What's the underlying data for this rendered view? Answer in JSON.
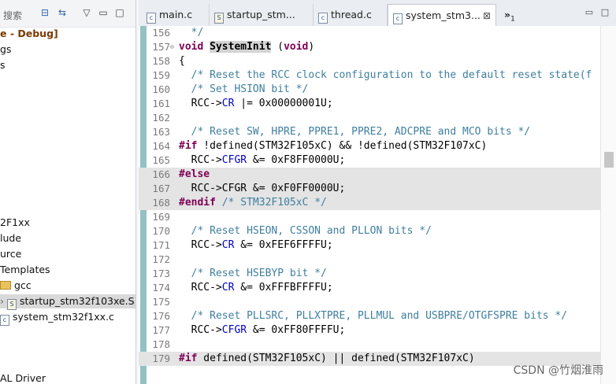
{
  "left_panel": {
    "search_placeholder": "搜索",
    "items": [
      {
        "label": "e - Debug]"
      },
      {
        "label": "gs"
      },
      {
        "label": "s"
      },
      {
        "label": "2F1xx"
      },
      {
        "label": "lude"
      },
      {
        "label": "urce"
      },
      {
        "label": "Templates"
      },
      {
        "label": "gcc"
      },
      {
        "label": "startup_stm32f103xe.S"
      },
      {
        "label": "system_stm32f1xx.c"
      },
      {
        "label": "AL Driver"
      }
    ]
  },
  "tabs": [
    {
      "label": "main.c",
      "icon": "c-file-icon"
    },
    {
      "label": "startup_stm...",
      "icon": "asm-file-icon"
    },
    {
      "label": "thread.c",
      "icon": "c-file-icon"
    },
    {
      "label": "system_stm3...",
      "icon": "c-file-icon",
      "active": true
    }
  ],
  "tab_overflow": {
    "label": "»",
    "count": "1"
  },
  "code_lines": [
    {
      "n": "156",
      "t": "  */"
    },
    {
      "n": "157",
      "t": "void SystemInit (void)"
    },
    {
      "n": "158",
      "t": "{"
    },
    {
      "n": "159",
      "t": "  /* Reset the RCC clock configuration to the default reset state(f"
    },
    {
      "n": "160",
      "t": "  /* Set HSION bit */"
    },
    {
      "n": "161",
      "t": "  RCC->CR |= 0x00000001U;"
    },
    {
      "n": "162",
      "t": ""
    },
    {
      "n": "163",
      "t": "  /* Reset SW, HPRE, PPRE1, PPRE2, ADCPRE and MCO bits */"
    },
    {
      "n": "164",
      "t": "#if !defined(STM32F105xC) && !defined(STM32F107xC)"
    },
    {
      "n": "165",
      "t": "  RCC->CFGR &= 0xF8FF0000U;"
    },
    {
      "n": "166",
      "t": "#else"
    },
    {
      "n": "167",
      "t": "  RCC->CFGR &= 0xF0FF0000U;"
    },
    {
      "n": "168",
      "t": "#endif /* STM32F105xC */"
    },
    {
      "n": "169",
      "t": ""
    },
    {
      "n": "170",
      "t": "  /* Reset HSEON, CSSON and PLLON bits */"
    },
    {
      "n": "171",
      "t": "  RCC->CR &= 0xFEF6FFFFU;"
    },
    {
      "n": "172",
      "t": ""
    },
    {
      "n": "173",
      "t": "  /* Reset HSEBYP bit */"
    },
    {
      "n": "174",
      "t": "  RCC->CR &= 0xFFFBFFFFU;"
    },
    {
      "n": "175",
      "t": ""
    },
    {
      "n": "176",
      "t": "  /* Reset PLLSRC, PLLXTPRE, PLLMUL and USBPRE/OTGFSPRE bits */"
    },
    {
      "n": "177",
      "t": "  RCC->CFGR &= 0xFF80FFFFU;"
    },
    {
      "n": "178",
      "t": ""
    },
    {
      "n": "179",
      "t": "#if defined(STM32F105xC) || defined(STM32F107xC)"
    }
  ],
  "watermark": "CSDN @竹烟淮雨",
  "colors": {
    "keyword": "#7f0055",
    "comment": "#3f7f9f",
    "field": "#0000c0",
    "inactive_bg": "#e4e4e4"
  }
}
